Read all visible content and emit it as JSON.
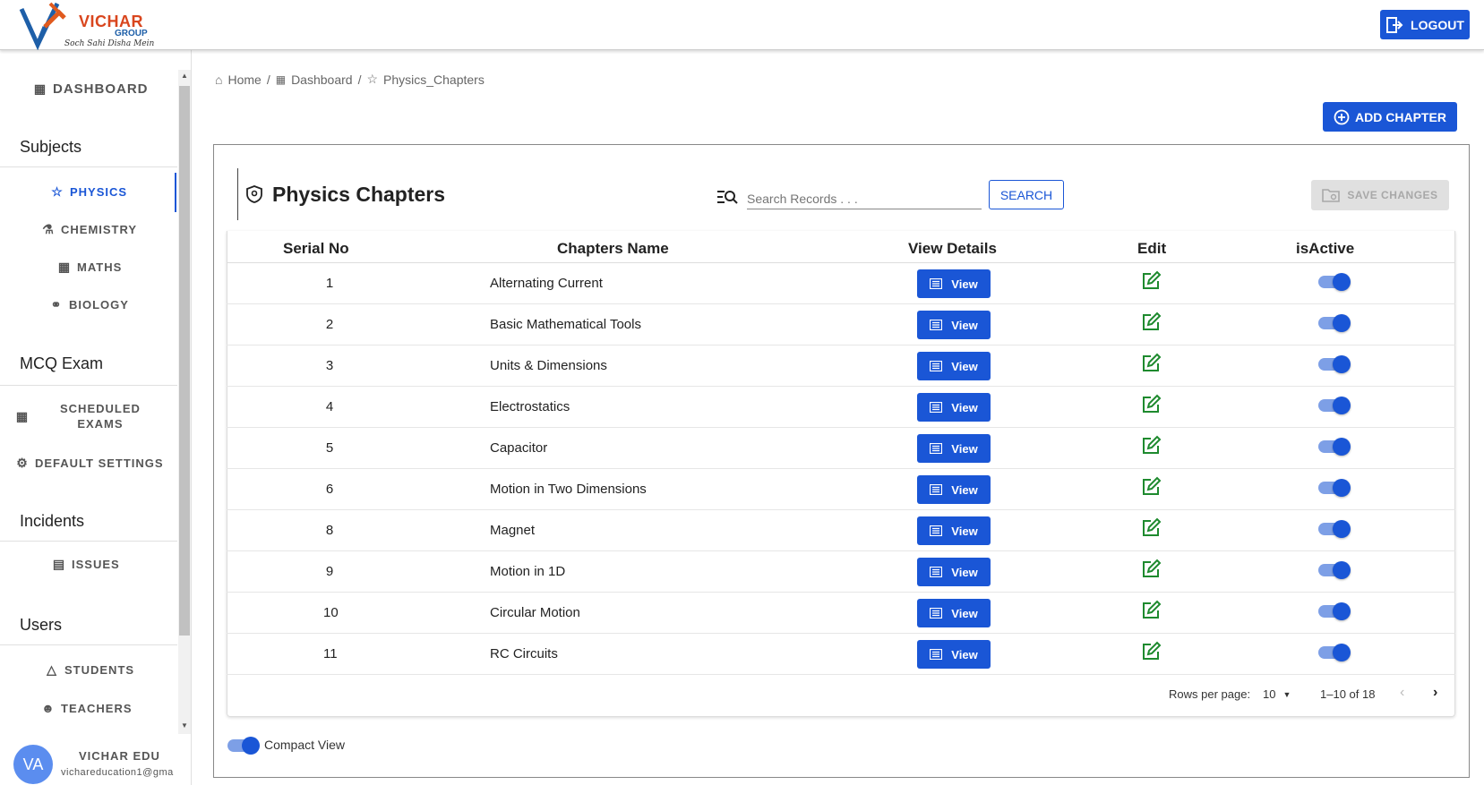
{
  "app": {
    "brand": "VICHAR",
    "brand_group": "GROUP",
    "tagline": "Soch Sahi Disha Mein",
    "logout_label": "LOGOUT"
  },
  "sidebar": {
    "dashboard": "DASHBOARD",
    "sections": {
      "subjects": "Subjects",
      "mcq": "MCQ Exam",
      "incidents": "Incidents",
      "users": "Users"
    },
    "items": {
      "physics": "PHYSICS",
      "chemistry": "CHEMISTRY",
      "maths": "MATHS",
      "biology": "BIOLOGY",
      "scheduled_1": "SCHEDULED",
      "scheduled_2": "EXAMS",
      "default_settings": "DEFAULT SETTINGS",
      "issues": "ISSUES",
      "students": "STUDENTS",
      "teachers": "TEACHERS"
    },
    "user": {
      "initials": "VA",
      "name": "VICHAR EDU",
      "email": "vichareducation1@gma"
    }
  },
  "breadcrumb": {
    "home": "Home",
    "sep": "/",
    "dashboard": "Dashboard",
    "current": "Physics_Chapters"
  },
  "actions": {
    "add_chapter": "ADD CHAPTER",
    "search_placeholder": "Search Records . . .",
    "search": "SEARCH",
    "save_changes": "SAVE CHANGES"
  },
  "card": {
    "title": "Physics Chapters"
  },
  "table": {
    "headers": {
      "serial": "Serial No",
      "name": "Chapters Name",
      "view": "View Details",
      "edit": "Edit",
      "active": "isActive"
    },
    "view_label": "View",
    "rows": [
      {
        "serial": "1",
        "name": "Alternating Current",
        "active": true
      },
      {
        "serial": "2",
        "name": "Basic Mathematical Tools",
        "active": true
      },
      {
        "serial": "3",
        "name": "Units & Dimensions",
        "active": true
      },
      {
        "serial": "4",
        "name": "Electrostatics",
        "active": true
      },
      {
        "serial": "5",
        "name": "Capacitor",
        "active": true
      },
      {
        "serial": "6",
        "name": "Motion in Two Dimensions",
        "active": true
      },
      {
        "serial": "8",
        "name": "Magnet",
        "active": true
      },
      {
        "serial": "9",
        "name": "Motion in 1D",
        "active": true
      },
      {
        "serial": "10",
        "name": "Circular Motion",
        "active": true
      },
      {
        "serial": "11",
        "name": "RC Circuits",
        "active": true
      }
    ]
  },
  "pagination": {
    "rows_per_page_label": "Rows per page:",
    "rows_per_page": "10",
    "range": "1–10 of 18"
  },
  "compact_view": {
    "label": "Compact View",
    "on": true
  },
  "colors": {
    "primary": "#1a56d6",
    "edit": "#1e8a2e"
  }
}
